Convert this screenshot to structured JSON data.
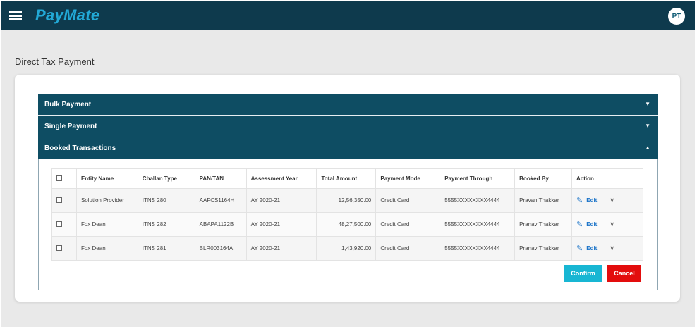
{
  "app": {
    "logo": "PayMate",
    "avatar_initials": "PT"
  },
  "page": {
    "title": "Direct Tax Payment"
  },
  "accordion": {
    "sections": [
      {
        "label": "Bulk Payment",
        "expanded": false,
        "arrow": "▼"
      },
      {
        "label": "Single Payment",
        "expanded": false,
        "arrow": "▼"
      },
      {
        "label": "Booked Transactions",
        "expanded": true,
        "arrow": "▲"
      }
    ]
  },
  "table": {
    "headers": [
      "",
      "Entity Name",
      "Challan Type",
      "PAN/TAN",
      "Assessment Year",
      "Total Amount",
      "Payment Mode",
      "Payment Through",
      "Booked By",
      "Action"
    ],
    "rows": [
      {
        "entity": "Solution Provider",
        "challan": "ITNS 280",
        "pan": "AAFCS1164H",
        "ay": "AY 2020-21",
        "amount": "12,56,350.00",
        "mode": "Credit Card",
        "through": "5555XXXXXXXX4444",
        "booked_by": "Pravan Thakkar",
        "edit": "Edit"
      },
      {
        "entity": "Fox Dean",
        "challan": "ITNS 282",
        "pan": "ABAPA1122B",
        "ay": "AY 2020-21",
        "amount": "48,27,500.00",
        "mode": "Credit Card",
        "through": "5555XXXXXXXX4444",
        "booked_by": "Pranav Thakkar",
        "edit": "Edit"
      },
      {
        "entity": "Fox Dean",
        "challan": "ITNS 281",
        "pan": "BLR003164A",
        "ay": "AY 2020-21",
        "amount": "1,43,920.00",
        "mode": "Credit Card",
        "through": "5555XXXXXXXX4444",
        "booked_by": "Pranav Thakkar",
        "edit": "Edit"
      }
    ]
  },
  "buttons": {
    "confirm": "Confirm",
    "cancel": "Cancel"
  },
  "colors": {
    "header_bg": "#0e3a4d",
    "accordion_bg": "#0e4d63",
    "logo": "#22a9d6",
    "confirm": "#18b6d3",
    "cancel": "#e30d0d",
    "edit": "#1a73c8"
  },
  "icons": {
    "menu": "hamburger-icon",
    "edit": "pencil-icon",
    "expand": "chevron-down-icon",
    "collapsed": "caret-down-icon",
    "expanded": "caret-up-icon"
  }
}
